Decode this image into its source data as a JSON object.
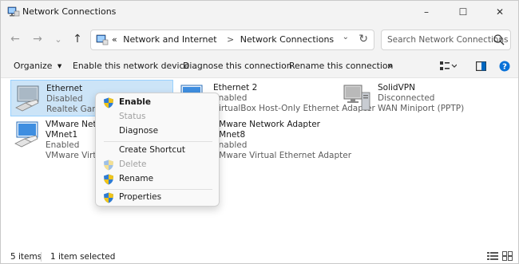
{
  "window": {
    "title": "Network Connections",
    "controls": {
      "minimize": "–",
      "maximize": "☐",
      "close": "✕"
    }
  },
  "nav": {
    "back": "←",
    "forward": "→",
    "recent": "⌄",
    "up": "↑"
  },
  "address": {
    "overflow": "«",
    "crumbs": [
      "Network and Internet",
      "Network Connections"
    ],
    "separator": ">",
    "dropdown": "⌄",
    "refresh": "↻"
  },
  "search": {
    "placeholder": "Search Network Connections"
  },
  "commandbar": {
    "organize": "Organize",
    "organize_caret": "▾",
    "enable": "Enable this network device",
    "diagnose": "Diagnose this connection",
    "rename": "Rename this connection",
    "more": "»"
  },
  "connections": [
    {
      "name": "Ethernet",
      "status": "Disabled",
      "adapter": "Realtek Gaming GbE Family Controller",
      "selected": true
    },
    {
      "name": "Ethernet 2",
      "status": "Enabled",
      "adapter": "VirtualBox Host-Only Ethernet Adapter",
      "selected": false
    },
    {
      "name": "SolidVPN",
      "status": "Disconnected",
      "adapter": "WAN Miniport (PPTP)",
      "selected": false
    },
    {
      "name": "VMware Network Adapter VMnet1",
      "status": "Enabled",
      "adapter": "VMware Virtual Ethernet Adapter",
      "selected": false
    },
    {
      "name": "VMware Network Adapter VMnet8",
      "status": "Enabled",
      "adapter": "VMware Virtual Ethernet Adapter",
      "selected": false
    }
  ],
  "context_menu": {
    "enable": "Enable",
    "status": "Status",
    "diagnose": "Diagnose",
    "create_shortcut": "Create Shortcut",
    "delete": "Delete",
    "rename": "Rename",
    "properties": "Properties"
  },
  "statusbar": {
    "items": "5 items",
    "selected": "1 item selected"
  },
  "colors": {
    "accent": "#0067c0",
    "selection": "#cce4f7",
    "chrome": "#f3f3f3"
  }
}
